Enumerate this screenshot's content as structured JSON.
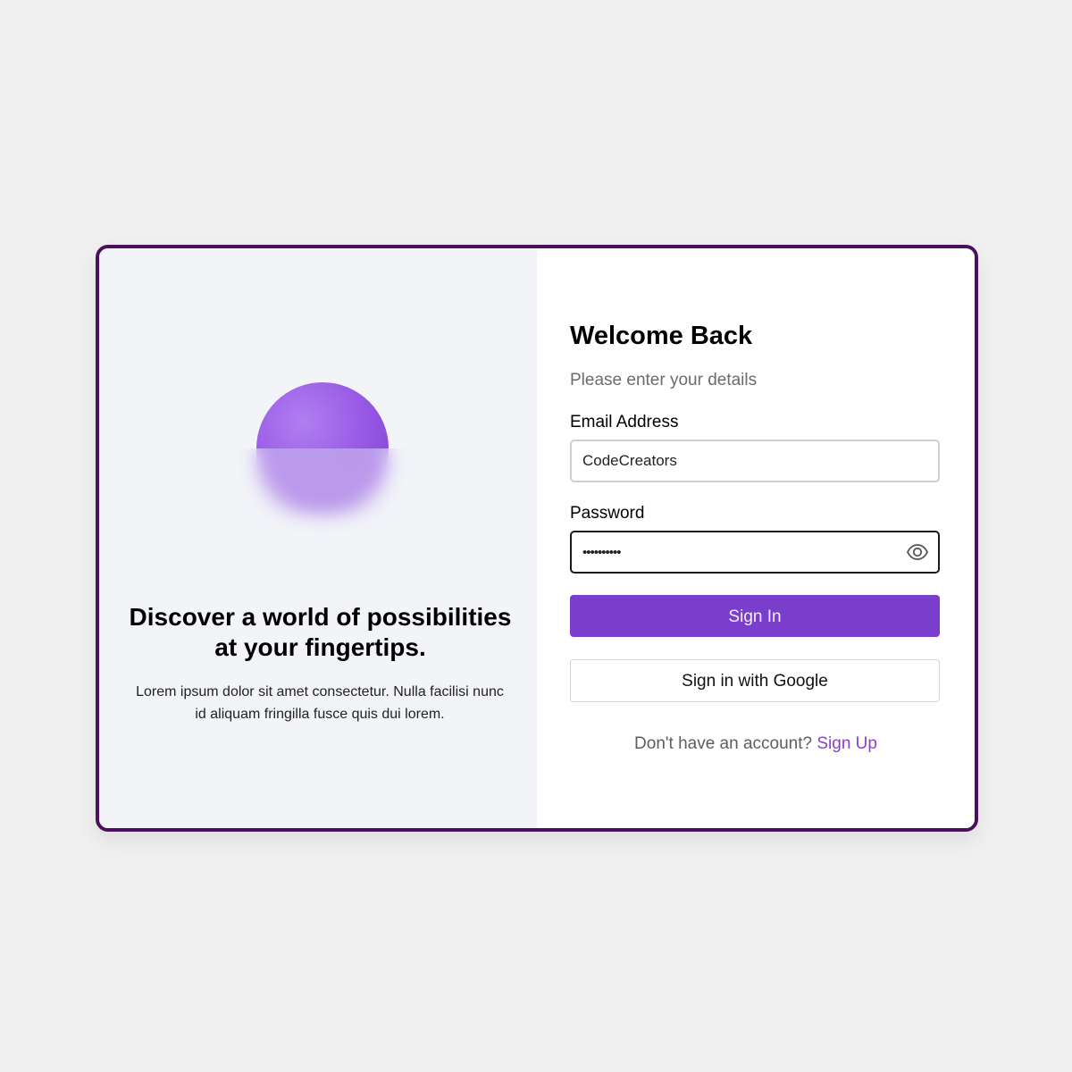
{
  "hero": {
    "title": "Discover a world of possibilities at your fingertips.",
    "description": "Lorem ipsum dolor sit amet consectetur. Nulla facilisi nunc id aliquam fringilla fusce quis dui lorem."
  },
  "form": {
    "title": "Welcome Back",
    "subtitle": "Please enter your details",
    "email_label": "Email Address",
    "email_value": "CodeCreators",
    "password_label": "Password",
    "password_value": "••••••••••",
    "password_toggle_icon": "eye-icon",
    "signin_label": "Sign In",
    "google_label": "Sign in with Google",
    "footer_text": "Don't have an account?",
    "signup_link": "Sign Up"
  },
  "colors": {
    "accent": "#7b3dcc",
    "card_border": "#4b0f5c",
    "left_panel_bg": "#f2f4f8",
    "page_bg": "#f0f0f0",
    "link": "#8a3fd1"
  }
}
